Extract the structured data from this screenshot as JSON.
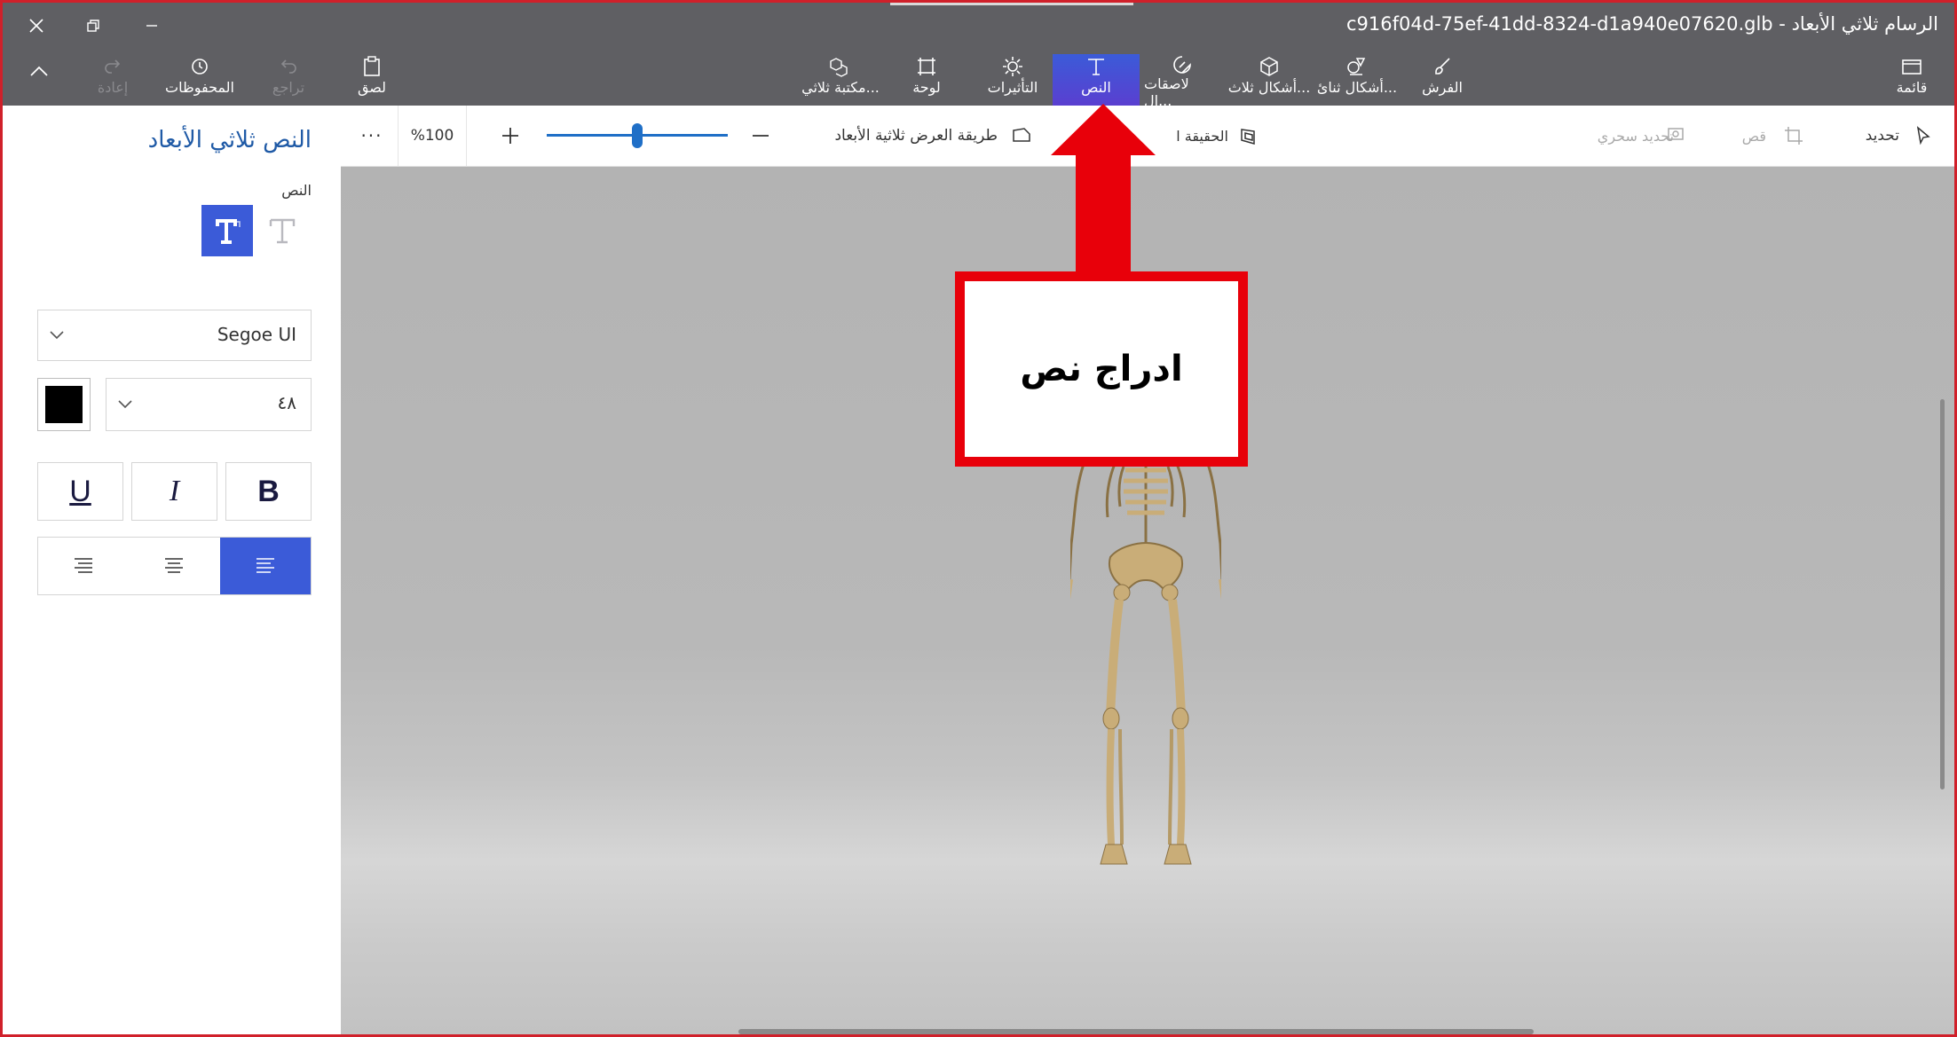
{
  "window": {
    "title": "c916f04d-75ef-41dd-8324-d1a940e07620.glb - الرسام ثلاثي الأبعاد"
  },
  "toolbar": {
    "menu_label": "قائمة",
    "items": [
      {
        "label": "الفرش",
        "icon": "brush-icon"
      },
      {
        "label": "أشكال ثنائ...",
        "icon": "2d-shapes-icon"
      },
      {
        "label": "أشكال ثلاث...",
        "icon": "3d-shapes-icon"
      },
      {
        "label": "لاصقات ال...",
        "icon": "stickers-icon"
      },
      {
        "label": "النص",
        "icon": "text-icon",
        "active": true
      },
      {
        "label": "التأثيرات",
        "icon": "effects-icon"
      },
      {
        "label": "لوحة",
        "icon": "canvas-icon"
      },
      {
        "label": "مكتبة ثلاثي...",
        "icon": "3d-library-icon"
      }
    ],
    "paste_label": "لصق",
    "undo_label": "تراجع",
    "history_label": "المحفوظات",
    "redo_label": "إعادة"
  },
  "subtoolbar": {
    "select_label": "تحديد",
    "crop_label": "قص",
    "magic_select_label": "تحديد سحري",
    "mixed_reality_label": "الحقيقة ا",
    "view_mode_label": "طريقة العرض ثلاثية الأبعاد",
    "zoom_value": "%100",
    "zoom_level": 0.5,
    "more_label": "···"
  },
  "panel": {
    "title": "النص ثلاثي الأبعاد",
    "text_label": "النص",
    "font_name": "Segoe UI",
    "font_size": "٤٨",
    "text_color": "#000000",
    "bold_label": "B",
    "italic_label": "I",
    "underline_label": "U"
  },
  "callout": {
    "text": "ادراج نص"
  },
  "colors": {
    "accent": "#3b5bd8",
    "annotation_red": "#e8000a",
    "toolbar_bg": "#5f5f63"
  }
}
